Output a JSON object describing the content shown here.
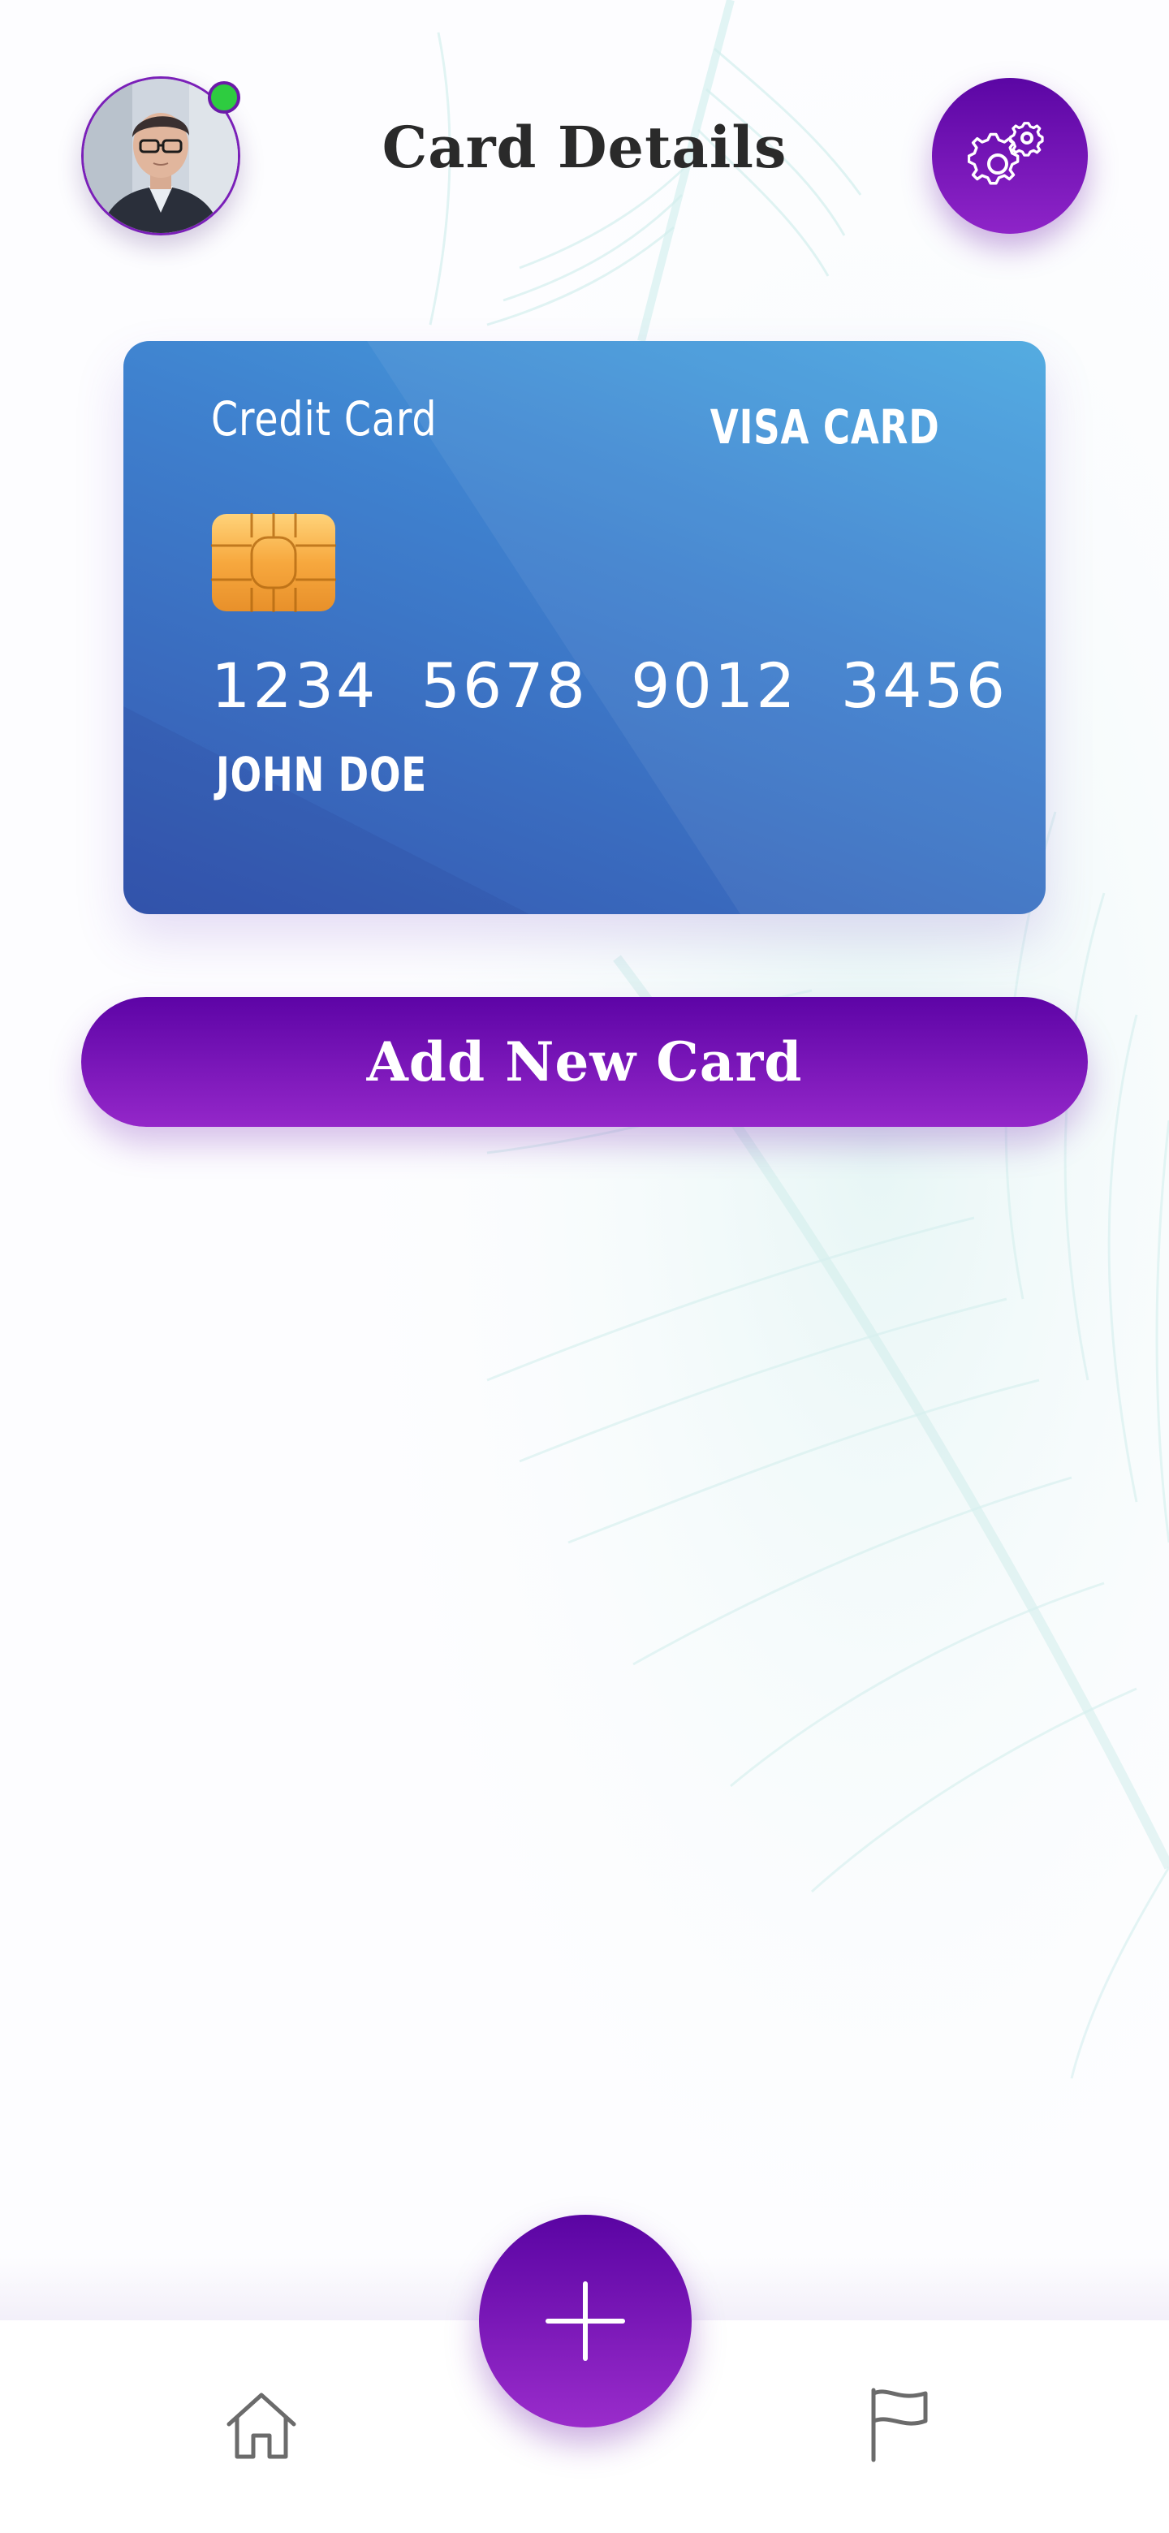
{
  "header": {
    "title": "Card Details",
    "avatar_icon": "user-avatar",
    "status": "online",
    "status_color": "#2ecc40",
    "settings_icon": "gears-icon"
  },
  "card": {
    "type_label": "Credit Card",
    "brand_label": "VISA CARD",
    "number": "1234   5678   9012   3456",
    "holder": "JOHN DOE",
    "chip_icon": "chip-icon"
  },
  "actions": {
    "add_card_label": "Add New Card"
  },
  "bottom_nav": {
    "home_icon": "home-icon",
    "fab_icon": "plus-icon",
    "flag_icon": "flag-icon"
  },
  "colors": {
    "accent": "#6a0fb0",
    "accent_light": "#9427c9",
    "card_top": "#4aa7e0",
    "card_bottom": "#3557b0"
  }
}
